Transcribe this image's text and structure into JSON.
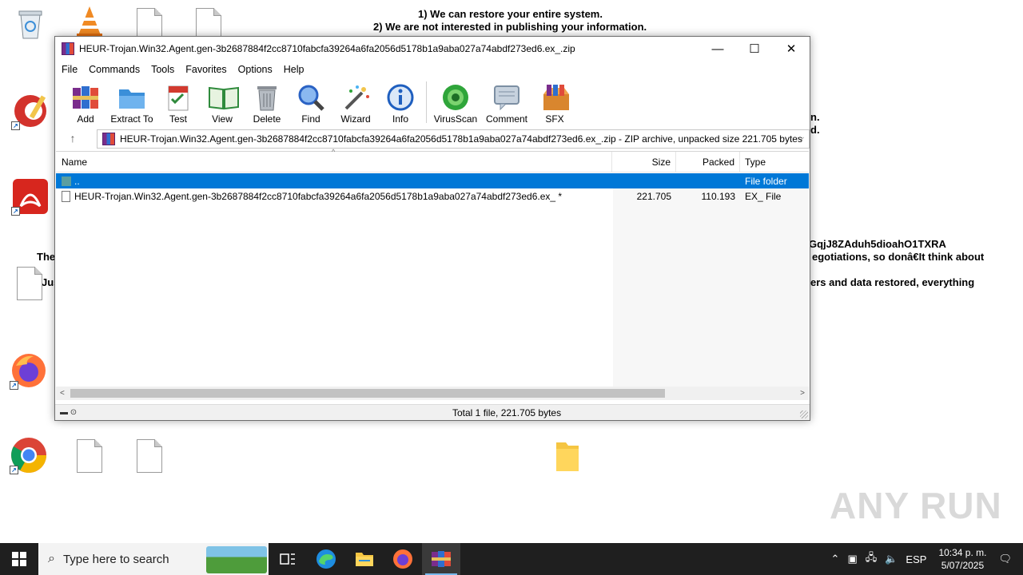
{
  "desktop_note": {
    "line1": "1) We can restore your entire system.",
    "line2": "2) We are not interested in publishing your information.",
    "right1": "n.",
    "right2": "d.",
    "left_the": "The",
    "left_jus": "Jus",
    "right_id": "GqjJ8ZAduh5dioahO1TXRA",
    "right_neg": "egotiations, so donâ€It think about",
    "right_restore": "ers and data restored, everything"
  },
  "window": {
    "title": "HEUR-Trojan.Win32.Agent.gen-3b2687884f2cc8710fabcfa39264a6fa2056d5178b1a9aba027a74abdf273ed6.ex_.zip",
    "minimize": "—",
    "maximize": "☐",
    "close": "✕"
  },
  "menu": [
    "File",
    "Commands",
    "Tools",
    "Favorites",
    "Options",
    "Help"
  ],
  "toolbar": [
    {
      "label": "Add",
      "icon": "add-icon",
      "color": "#7a2d8c"
    },
    {
      "label": "Extract To",
      "icon": "extract-icon",
      "color": "#3b8fd9"
    },
    {
      "label": "Test",
      "icon": "test-icon",
      "color": "#d23a2f"
    },
    {
      "label": "View",
      "icon": "view-icon",
      "color": "#2f8a3c"
    },
    {
      "label": "Delete",
      "icon": "delete-icon",
      "color": "#8a8f96"
    },
    {
      "label": "Find",
      "icon": "find-icon",
      "color": "#2a62c4"
    },
    {
      "label": "Wizard",
      "icon": "wizard-icon",
      "color": "#6b6b6b"
    },
    {
      "label": "Info",
      "icon": "info-icon",
      "color": "#1f5fbf"
    },
    {
      "label": "VirusScan",
      "icon": "virusscan-icon",
      "color": "#2fa53a"
    },
    {
      "label": "Comment",
      "icon": "comment-icon",
      "color": "#7c8fa3"
    },
    {
      "label": "SFX",
      "icon": "sfx-icon",
      "color": "#d9862e"
    }
  ],
  "address": {
    "path": "HEUR-Trojan.Win32.Agent.gen-3b2687884f2cc8710fabcfa39264a6fa2056d5178b1a9aba027a74abdf273ed6.ex_.zip - ZIP archive, unpacked size 221.705 bytes"
  },
  "columns": {
    "name": "Name",
    "size": "Size",
    "packed": "Packed",
    "type": "Type"
  },
  "rows": [
    {
      "name": "..",
      "size": "",
      "packed": "",
      "type": "File folder",
      "selected": true
    },
    {
      "name": "HEUR-Trojan.Win32.Agent.gen-3b2687884f2cc8710fabcfa39264a6fa2056d5178b1a9aba027a74abdf273ed6.ex_ *",
      "size": "221.705",
      "packed": "110.193",
      "type": "EX_ File",
      "selected": false
    }
  ],
  "status": {
    "text": "Total 1 file, 221.705 bytes"
  },
  "taskbar": {
    "search_placeholder": "Type here to search",
    "lang": "ESP",
    "time": "10:34 p. m.",
    "date": "5/07/2025"
  },
  "watermark": "ANY RUN",
  "colors": {
    "selection": "#0078d7",
    "taskbar": "#1f1f1f"
  }
}
